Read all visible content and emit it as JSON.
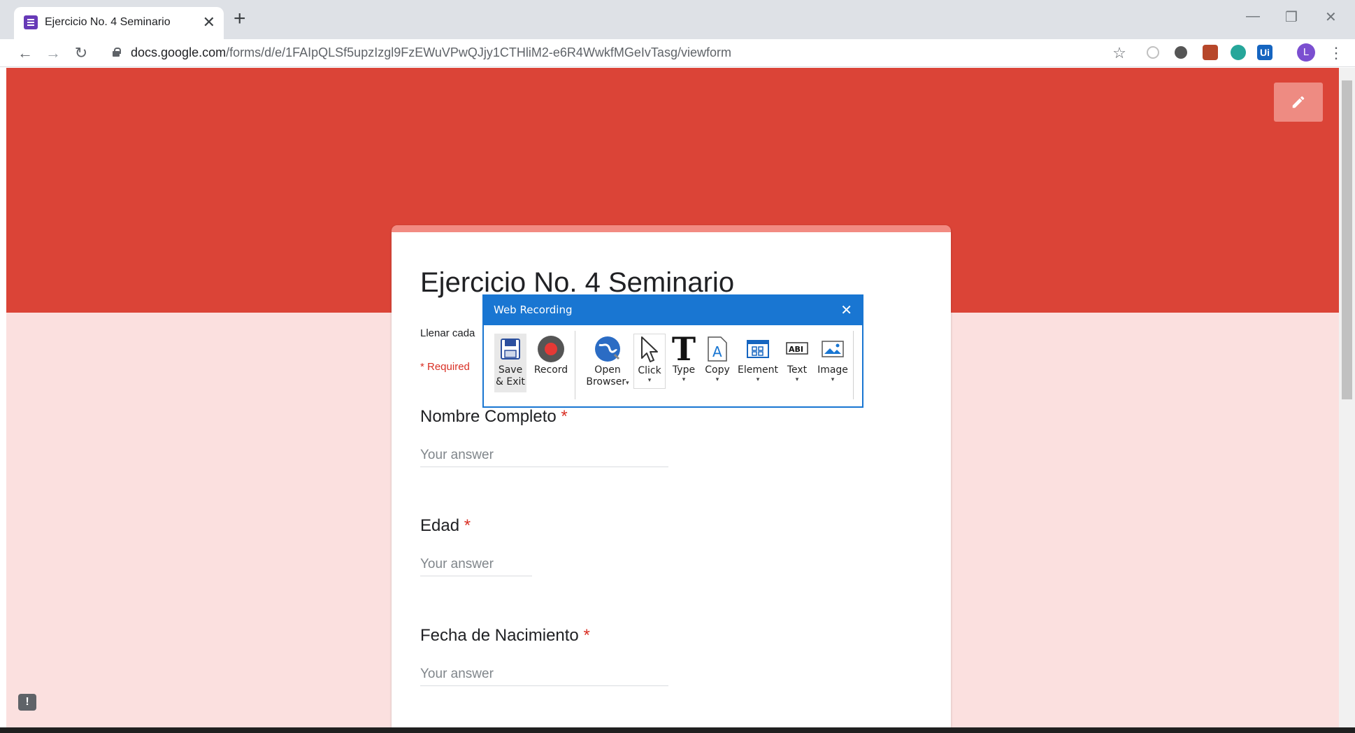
{
  "browser": {
    "tab_title": "Ejercicio No. 4 Seminario",
    "tab_close": "✕",
    "new_tab": "+",
    "url_host": "docs.google.com",
    "url_path": "/forms/d/e/1FAIpQLSf5upzIzgl9FzEWuVPwQJjy1CTHliM2-e6R4WwkfMGeIvTasg/viewform",
    "avatar_initial": "L"
  },
  "form": {
    "title": "Ejercicio No. 4 Seminario",
    "description_partial": "Llenar cada",
    "required_note": "* Required",
    "questions": [
      {
        "label": "Nombre Completo",
        "required_mark": "*",
        "placeholder": "Your answer"
      },
      {
        "label": "Edad",
        "required_mark": "*",
        "placeholder": "Your answer"
      },
      {
        "label": "Fecha de Nacimiento",
        "required_mark": "*",
        "placeholder": "Your answer"
      }
    ]
  },
  "recorder": {
    "title": "Web Recording",
    "buttons": {
      "save_line1": "Save",
      "save_line2": "& Exit",
      "record": "Record",
      "open_line1": "Open",
      "open_line2": "Browser",
      "click": "Click",
      "type": "Type",
      "copy": "Copy",
      "element": "Element",
      "text": "Text",
      "image": "Image"
    },
    "colors": {
      "accent": "#1976d2",
      "record": "#e53935"
    }
  },
  "colors": {
    "banner": "#db4437",
    "page_bg": "#fbe0df",
    "required": "#d93025"
  }
}
